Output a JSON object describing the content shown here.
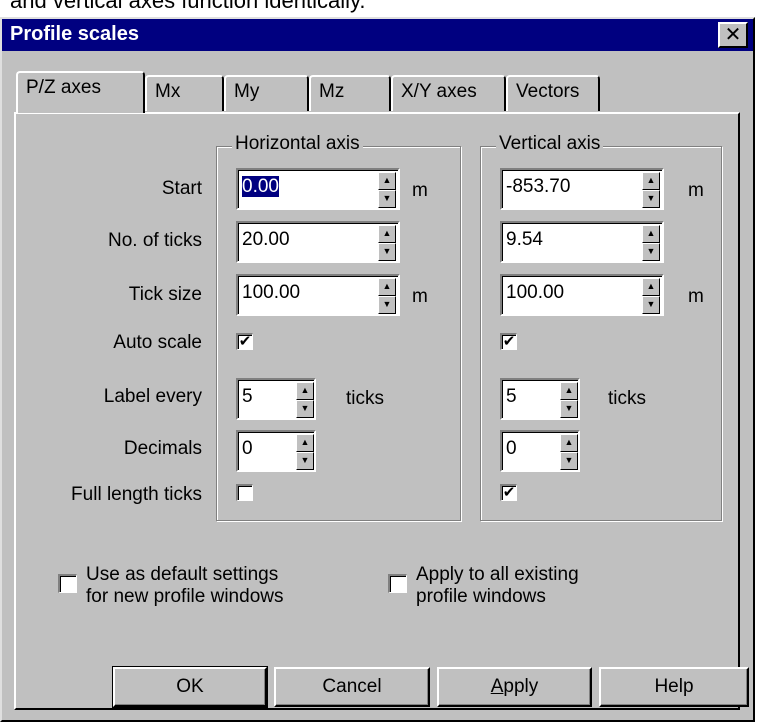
{
  "top_text": "and vertical axes function identically.",
  "window": {
    "title": "Profile scales",
    "close_glyph": "✕"
  },
  "tabs": [
    "P/Z axes",
    "Mx",
    "My",
    "Mz",
    "X/Y axes",
    "Vectors"
  ],
  "active_tab": "P/Z axes",
  "row_labels": {
    "start": "Start",
    "ticks": "No. of ticks",
    "tick_size": "Tick size",
    "auto_scale": "Auto scale",
    "label_every": "Label every",
    "decimals": "Decimals",
    "full_length": "Full length ticks"
  },
  "horizontal": {
    "title": "Horizontal axis",
    "start": "0.00",
    "start_unit": "m",
    "ticks": "20.00",
    "tick_size": "100.00",
    "tick_size_unit": "m",
    "auto_scale": true,
    "label_every": "5",
    "label_every_unit": "ticks",
    "decimals": "0",
    "full_length": false
  },
  "vertical": {
    "title": "Vertical axis",
    "start": "-853.70",
    "start_unit": "m",
    "ticks": "9.54",
    "tick_size": "100.00",
    "tick_size_unit": "m",
    "auto_scale": true,
    "label_every": "5",
    "label_every_unit": "ticks",
    "decimals": "0",
    "full_length": true
  },
  "options": {
    "default_line1": "Use as default settings",
    "default_line2": "for new profile windows",
    "default_checked": false,
    "apply_line1": "Apply to all existing",
    "apply_line2": "profile windows",
    "apply_checked": false
  },
  "buttons": {
    "ok": "OK",
    "cancel": "Cancel",
    "apply": "Apply",
    "help": "Help"
  },
  "check_glyph": "✔",
  "spin_up": "▲",
  "spin_down": "▼",
  "colors": {
    "titlebar": "#000080",
    "face": "#c0c0c0",
    "selection": "#000080"
  }
}
